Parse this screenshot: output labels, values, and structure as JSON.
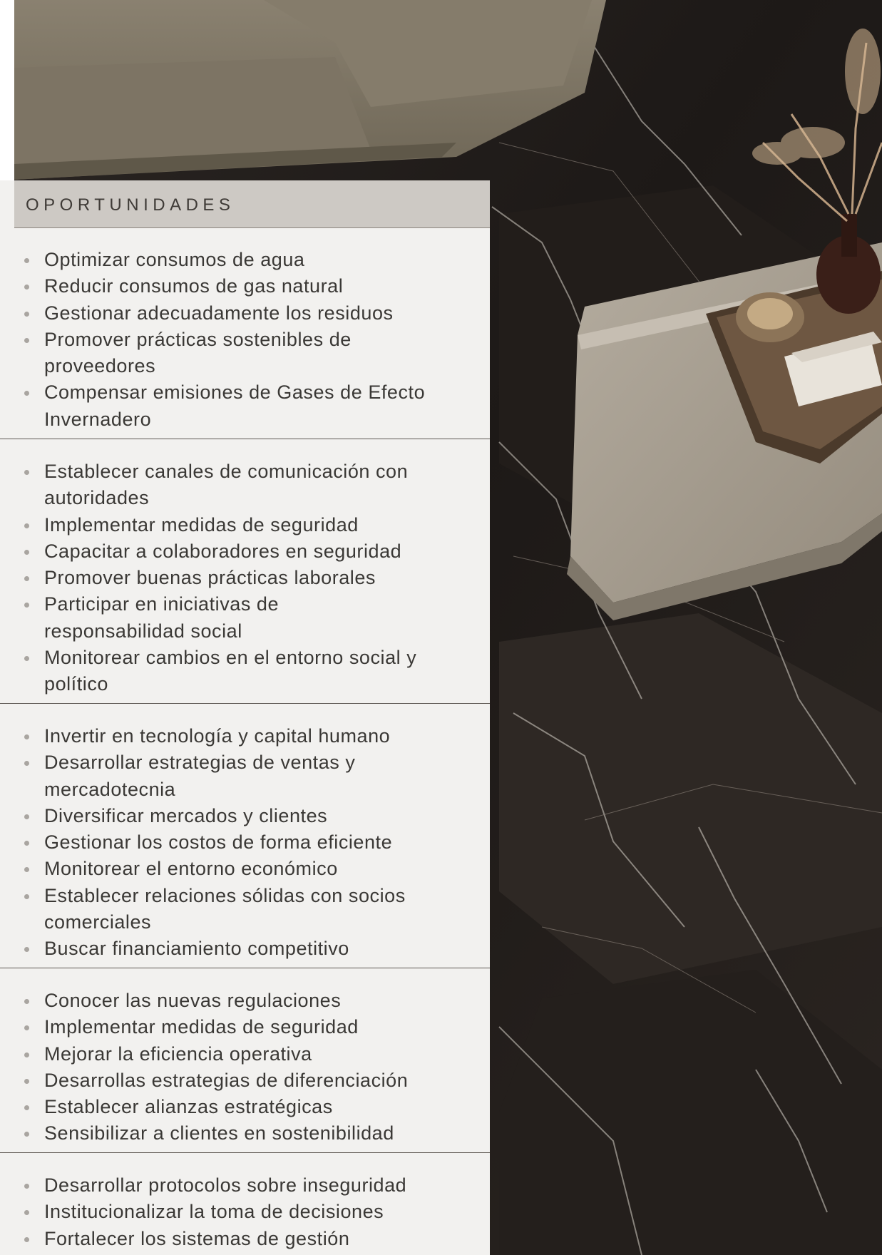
{
  "panel": {
    "title": "OPORTUNIDADES"
  },
  "sections": [
    {
      "items": [
        [
          "Optimizar consumos de agua"
        ],
        [
          "Reducir consumos de gas natural"
        ],
        [
          "Gestionar adecuadamente los residuos"
        ],
        [
          "Promover prácticas sostenibles de",
          "proveedores"
        ],
        [
          "Compensar emisiones de Gases de Efecto",
          "Invernadero"
        ]
      ]
    },
    {
      "items": [
        [
          "Establecer canales de comunicación con",
          "autoridades"
        ],
        [
          "Implementar medidas de seguridad"
        ],
        [
          "Capacitar a colaboradores en seguridad"
        ],
        [
          "Promover buenas prácticas laborales"
        ],
        [
          "Participar en iniciativas de",
          "responsabilidad social"
        ],
        [
          "Monitorear cambios en el entorno social y",
          "político"
        ]
      ]
    },
    {
      "items": [
        [
          "Invertir en tecnología y capital humano"
        ],
        [
          "Desarrollar estrategias de ventas y",
          "mercadotecnia"
        ],
        [
          "Diversificar mercados y clientes"
        ],
        [
          "Gestionar los costos de forma eficiente"
        ],
        [
          "Monitorear el entorno económico"
        ],
        [
          "Establecer relaciones sólidas con socios",
          "comerciales"
        ],
        [
          "Buscar financiamiento competitivo"
        ]
      ]
    },
    {
      "items": [
        [
          "Conocer las nuevas regulaciones"
        ],
        [
          "Implementar medidas de seguridad"
        ],
        [
          "Mejorar la eficiencia operativa"
        ],
        [
          "Desarrollas estrategias de diferenciación"
        ],
        [
          "Establecer alianzas estratégicas"
        ],
        [
          "Sensibilizar a clientes en sostenibilidad"
        ]
      ]
    },
    {
      "items": [
        [
          "Desarrollar protocolos sobre inseguridad"
        ],
        [
          "Institucionalizar la toma de decisiones"
        ],
        [
          "Fortalecer los sistemas de gestión"
        ]
      ]
    }
  ],
  "colors": {
    "panel_background": "#f2f1ef",
    "header_background": "#cdc9c4",
    "text": "#3a3835",
    "bullet": "#a9a5a0",
    "divider": "#5d5852"
  }
}
